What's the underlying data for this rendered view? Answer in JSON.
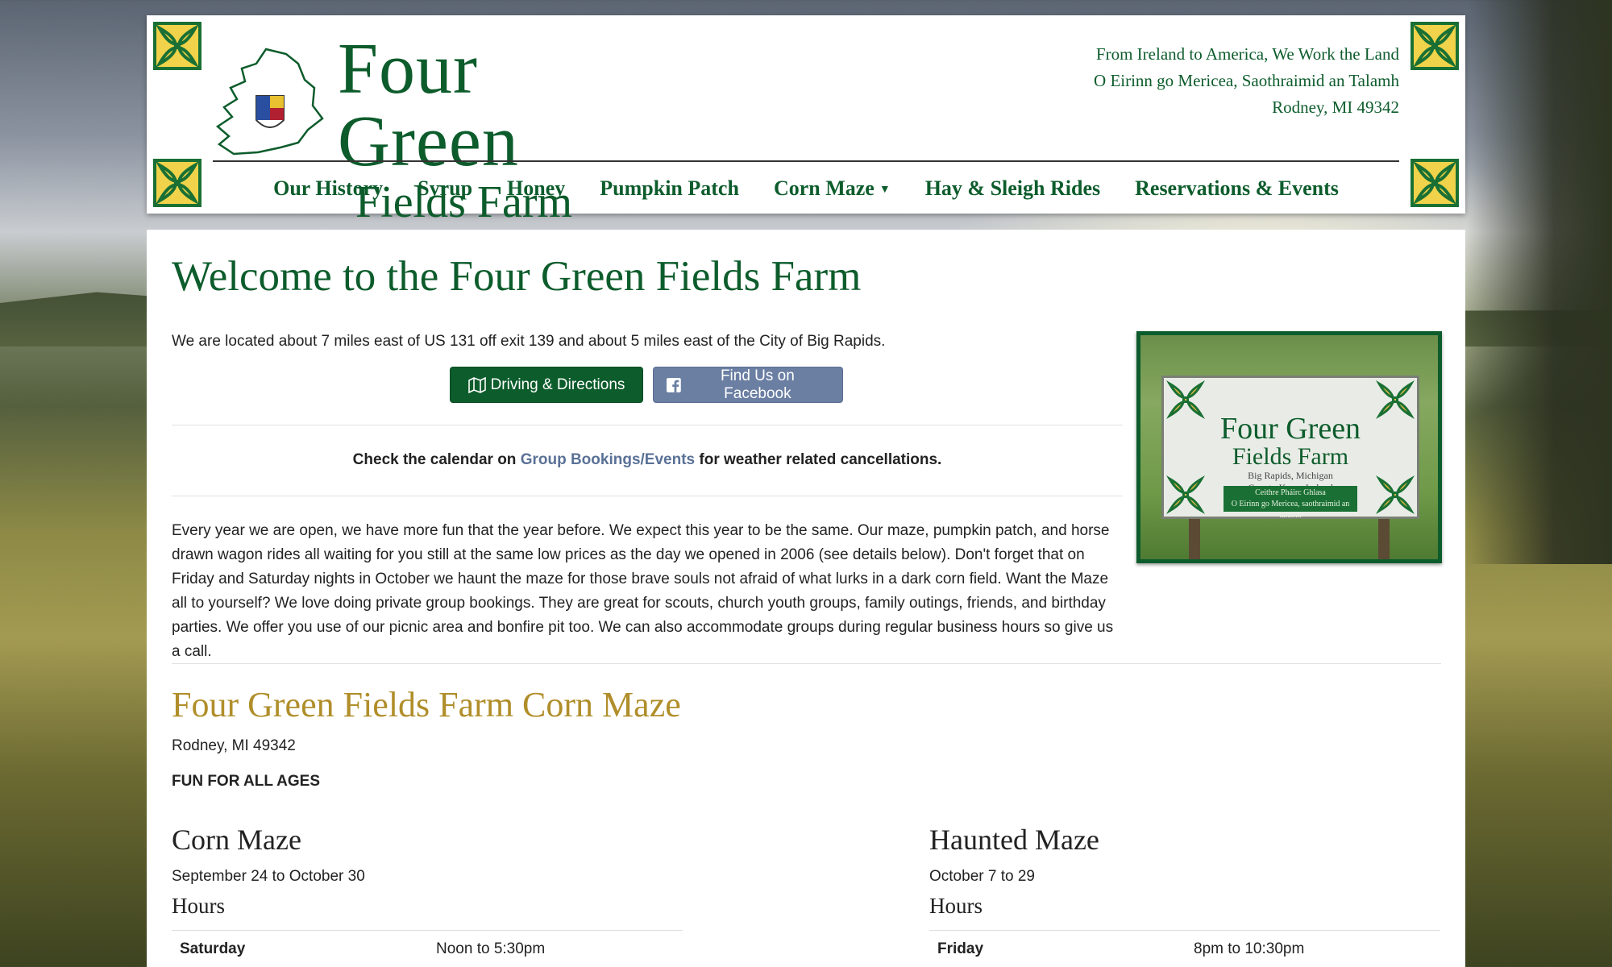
{
  "header": {
    "logo_line1": "Four Green",
    "logo_line2": "Fields Farm",
    "tagline": [
      "From Ireland to America, We Work the Land",
      "O Eirinn go Mericea, Saothraimid an Talamh",
      "Rodney, MI 49342"
    ],
    "nav": [
      {
        "label": "Our History"
      },
      {
        "label": "Syrup"
      },
      {
        "label": "Honey"
      },
      {
        "label": "Pumpkin Patch"
      },
      {
        "label": "Corn Maze"
      },
      {
        "label": "Hay & Sleigh Rides"
      },
      {
        "label": "Reservations & Events"
      }
    ]
  },
  "main": {
    "title": "Welcome to the Four Green Fields Farm",
    "intro": "We are located about 7 miles east of US 131 off exit 139 and about 5 miles east of the City of Big Rapids.",
    "btn_directions": "Driving & Directions",
    "btn_facebook": "Find Us on Facebook",
    "notice_before": "Check the calendar on ",
    "notice_link": "Group Bookings/Events",
    "notice_after": " for weather related cancellations.",
    "body": "Every year we are open, we have more fun that the year before. We expect this year to be the same. Our maze, pumpkin patch, and horse drawn wagon rides all waiting for you still at the same low prices as the day we opened in 2006 (see details below). Don't forget that on Friday and Saturday nights in October we haunt the maze for those brave souls not afraid of what lurks in a dark corn field. Want the Maze all to yourself? We love doing private group bookings. They are great for scouts, church youth groups, family outings, friends, and birthday parties. We offer you use of our picnic area and bonfire pit too. We can also accommodate groups during regular business hours so give us a call.",
    "photo_sign": {
      "line1": "Four Green",
      "line2": "Fields Farm",
      "line3": "Big Rapids, Michigan",
      "line4": "County Kerry, Ireland",
      "green1": "Ceithre Pháirc Ghlasa",
      "green2": "O Eirinn go Mericea, saothraimid an talamh"
    },
    "subtitle": "Four Green Fields Farm Corn Maze",
    "address": "Rodney, MI 49342",
    "ages": "FUN FOR ALL AGES",
    "corn": {
      "title": "Corn Maze",
      "dates": "September 24 to October 30",
      "hours_label": "Hours",
      "day": "Saturday",
      "time": "Noon to 5:30pm"
    },
    "haunted": {
      "title": "Haunted Maze",
      "dates": "October 7 to 29",
      "hours_label": "Hours",
      "day": "Friday",
      "time": "8pm to 10:30pm"
    }
  },
  "colors": {
    "brand_green": "#0d5c2c",
    "gold": "#b08e2a",
    "facebook_blue": "#6b7fa3"
  },
  "icons": {
    "directions": "map-icon",
    "facebook": "facebook-icon"
  }
}
